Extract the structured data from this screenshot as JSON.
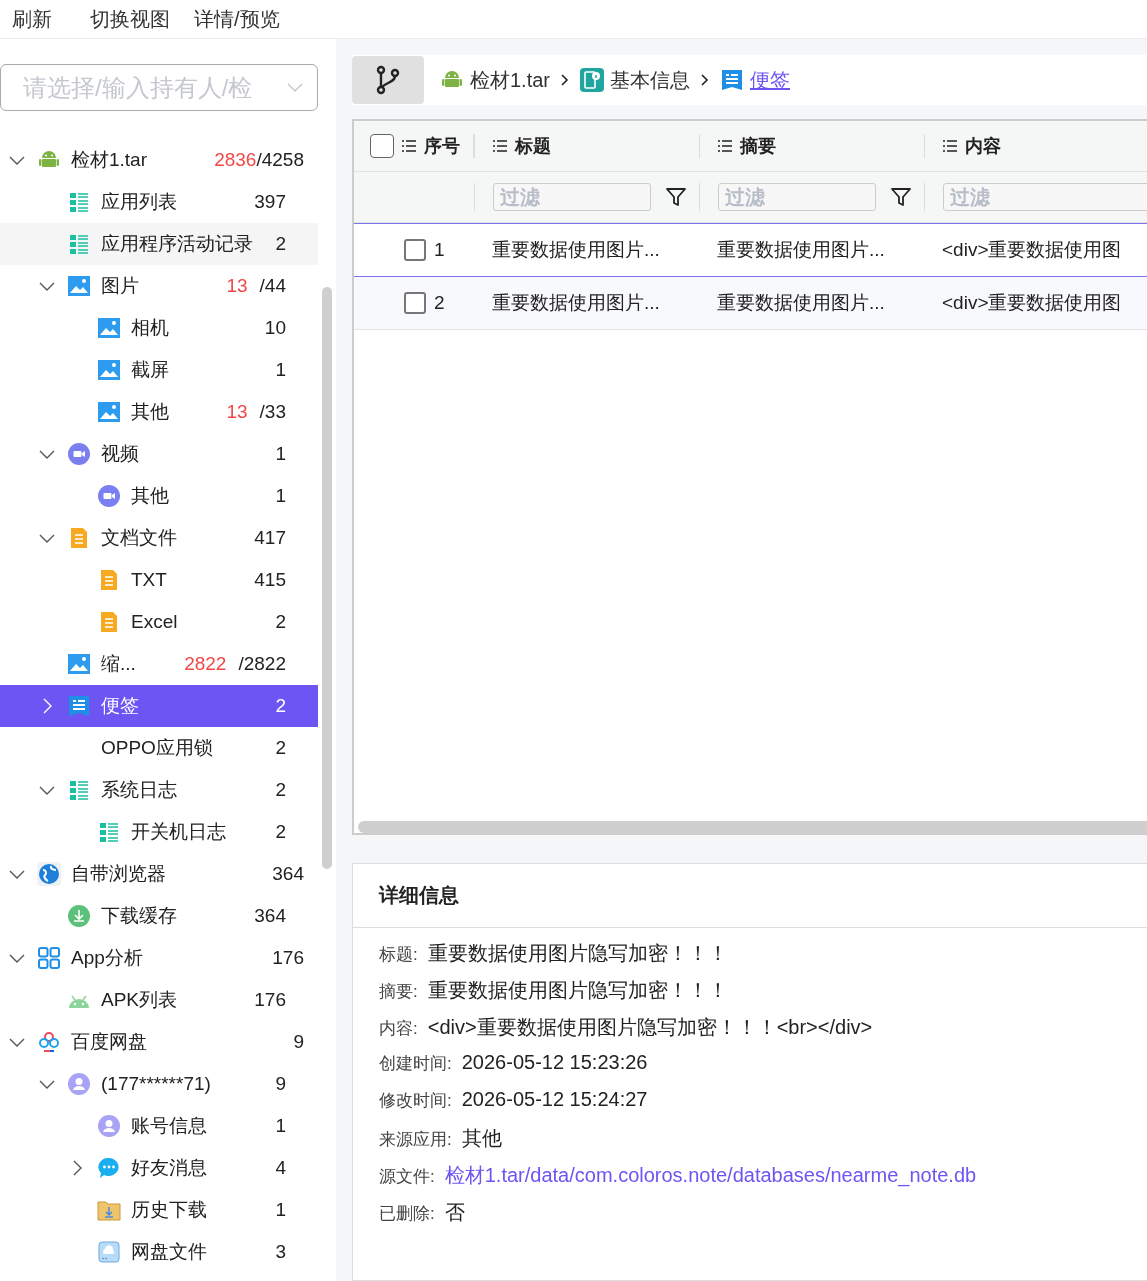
{
  "toolbar": {
    "buttons": [
      "刷新",
      "切换视图",
      "详情/预览"
    ]
  },
  "holder_select": {
    "placeholder": "请选择/输入持有人/检"
  },
  "tree": [
    {
      "label": "检材1.tar",
      "kind": "android",
      "expanded": true,
      "selected": false,
      "count_new": "2836",
      "count_total": "/4258",
      "children": [
        {
          "label": "应用列表",
          "kind": "list",
          "selected": false,
          "count": "397"
        },
        {
          "label": "应用程序活动记录",
          "kind": "list",
          "selected": false,
          "hovered": true,
          "count": "2"
        },
        {
          "label": "图片",
          "kind": "image",
          "expanded": true,
          "selected": false,
          "count_new": "13",
          "count_total": "/44",
          "children": [
            {
              "label": "相机",
              "kind": "image",
              "selected": false,
              "count": "10"
            },
            {
              "label": "截屏",
              "kind": "image",
              "selected": false,
              "count": "1"
            },
            {
              "label": "其他",
              "kind": "image",
              "selected": false,
              "count_new": "13",
              "count_total": "/33"
            }
          ]
        },
        {
          "label": "视频",
          "kind": "video",
          "expanded": true,
          "selected": false,
          "count": "1",
          "children": [
            {
              "label": "其他",
              "kind": "video",
              "selected": false,
              "count": "1"
            }
          ]
        },
        {
          "label": "文档文件",
          "kind": "doc",
          "expanded": true,
          "selected": false,
          "count": "417",
          "children": [
            {
              "label": "TXT",
              "kind": "doc",
              "selected": false,
              "count": "415"
            },
            {
              "label": "Excel",
              "kind": "doc",
              "selected": false,
              "count": "2"
            }
          ]
        },
        {
          "label": "缩...",
          "kind": "image",
          "selected": false,
          "count_new": "2822",
          "count_total": "/2822"
        },
        {
          "label": "便签",
          "kind": "note",
          "expanded": false,
          "selected": true,
          "count": "2"
        },
        {
          "label": "OPPO应用锁",
          "kind": "plain",
          "selected": false,
          "count": "2"
        },
        {
          "label": "系统日志",
          "kind": "list",
          "expanded": true,
          "selected": false,
          "count": "2",
          "children": [
            {
              "label": "开关机日志",
              "kind": "list",
              "selected": false,
              "count": "2"
            }
          ]
        }
      ]
    },
    {
      "label": "自带浏览器",
      "kind": "globe",
      "expanded": true,
      "selected": false,
      "count": "364",
      "children": [
        {
          "label": "下载缓存",
          "kind": "download",
          "selected": false,
          "count": "364"
        }
      ]
    },
    {
      "label": "App分析",
      "kind": "grid",
      "expanded": true,
      "selected": false,
      "count": "176",
      "children": [
        {
          "label": "APK列表",
          "kind": "apk",
          "selected": false,
          "count": "176"
        }
      ]
    },
    {
      "label": "百度网盘",
      "kind": "cloud",
      "expanded": true,
      "selected": false,
      "count": "9",
      "children": [
        {
          "label": "(177******71)",
          "kind": "user",
          "expanded": true,
          "selected": false,
          "count": "9",
          "children": [
            {
              "label": "账号信息",
              "kind": "user",
              "selected": false,
              "count": "1"
            },
            {
              "label": "好友消息",
              "kind": "chat",
              "expanded": false,
              "selected": false,
              "count": "4"
            },
            {
              "label": "历史下载",
              "kind": "folder",
              "selected": false,
              "count": "1"
            },
            {
              "label": "网盘文件",
              "kind": "disk",
              "selected": false,
              "count": "3"
            }
          ]
        }
      ]
    }
  ],
  "breadcrumb": [
    {
      "label": "检材1.tar",
      "kind": "android",
      "selected": false
    },
    {
      "label": "基本信息",
      "kind": "info",
      "selected": false
    },
    {
      "label": "便签",
      "kind": "note",
      "selected": true
    }
  ],
  "table": {
    "columns": [
      "序号",
      "标题",
      "摘要",
      "内容"
    ],
    "select_all_checked": false,
    "filter_placeholder": [
      "过滤",
      "过滤",
      "过滤"
    ],
    "rows": [
      {
        "index": "1",
        "title": "重要数据使用图片...",
        "summary": "重要数据使用图片...",
        "content": "<div>重要数据使用图",
        "checked": false,
        "selected": true
      },
      {
        "index": "2",
        "title": "重要数据使用图片...",
        "summary": "重要数据使用图片...",
        "content": "<div>重要数据使用图",
        "checked": false,
        "selected": false
      }
    ]
  },
  "details": {
    "title": "详细信息",
    "fields": [
      {
        "label": "标题:",
        "value": "重要数据使用图片隐写加密！！！",
        "kind": "text"
      },
      {
        "label": "摘要:",
        "value": "重要数据使用图片隐写加密！！！",
        "kind": "text"
      },
      {
        "label": "内容:",
        "value": "<div>重要数据使用图片隐写加密！！！<br></div>",
        "kind": "text"
      },
      {
        "label": "创建时间:",
        "value": "2026-05-12 15:23:26",
        "kind": "text"
      },
      {
        "label": "修改时间:",
        "value": "2026-05-12 15:24:27",
        "kind": "text"
      },
      {
        "label": "来源应用:",
        "value": "其他",
        "kind": "text"
      },
      {
        "label": "源文件:",
        "value": "检材1.tar/data/com.coloros.note/databases/nearme_note.db",
        "kind": "link"
      },
      {
        "label": "已删除:",
        "value": "否",
        "kind": "text"
      }
    ]
  }
}
